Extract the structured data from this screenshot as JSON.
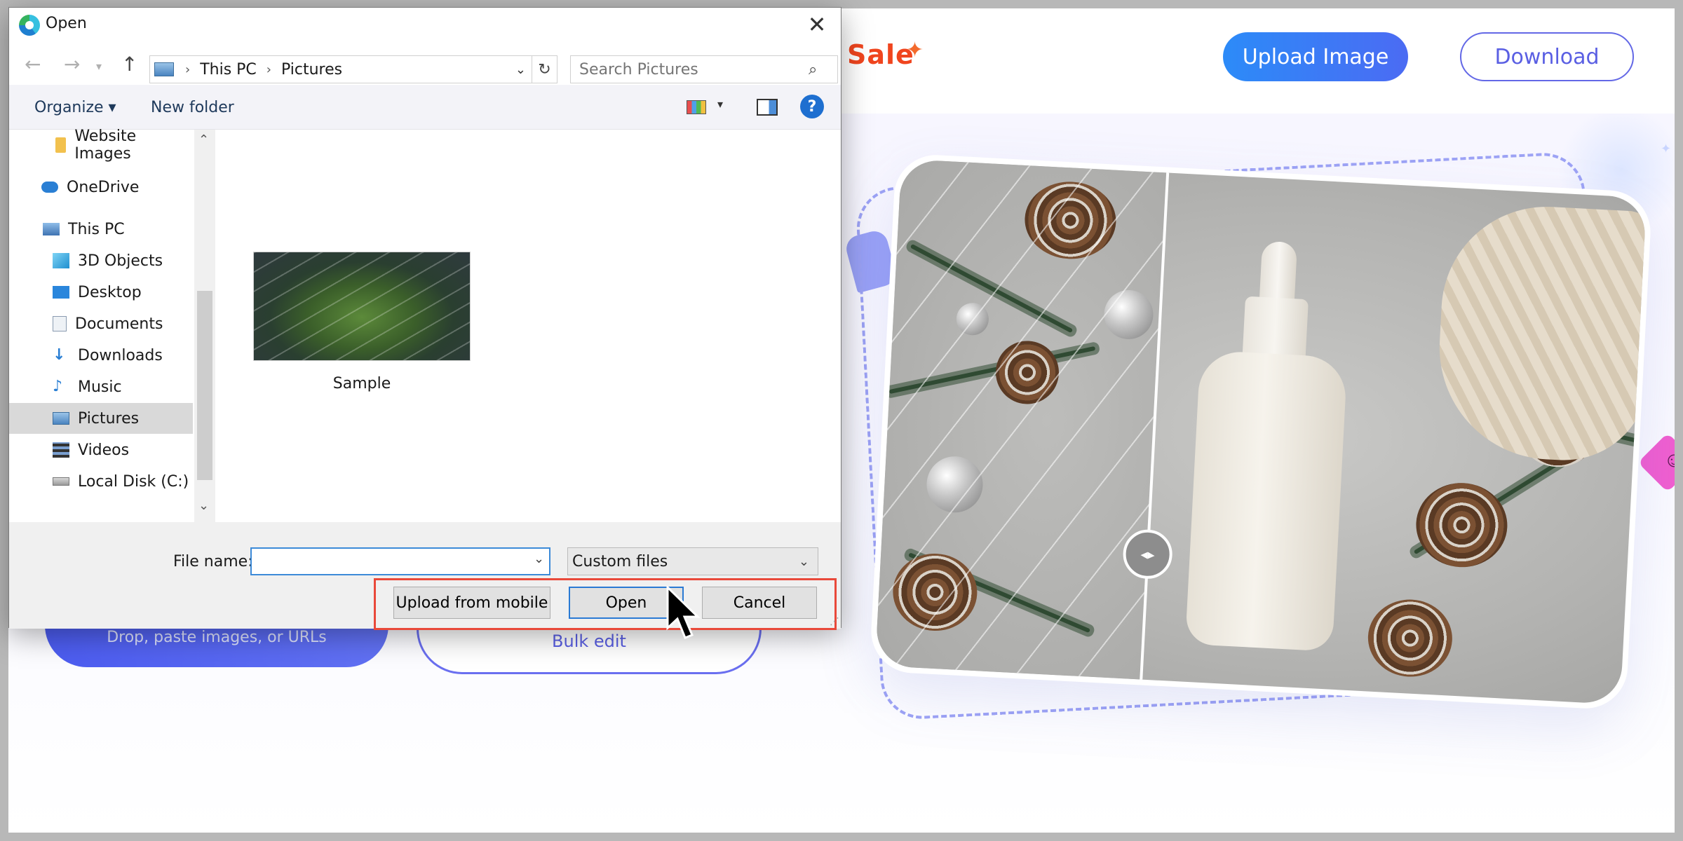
{
  "webpage": {
    "sale_text": "Sale",
    "upload_image_label": "Upload Image",
    "download_label": "Download",
    "drop_text": "Drop, paste images, or URLs",
    "bulk_edit_label": "Bulk edit",
    "handle_glyph": "◂▸"
  },
  "dialog": {
    "title": "Open",
    "breadcrumb": [
      "This PC",
      "Pictures"
    ],
    "search_placeholder": "Search Pictures",
    "toolbar": {
      "organize_label": "Organize ▾",
      "new_folder_label": "New folder",
      "help_label": "?"
    },
    "nav_items": [
      {
        "label": "Website Images",
        "icon": "folder-icon"
      },
      {
        "label": "OneDrive",
        "icon": "cloud-icon"
      },
      {
        "label": "This PC",
        "icon": "computer-icon"
      },
      {
        "label": "3D Objects",
        "icon": "cube-icon"
      },
      {
        "label": "Desktop",
        "icon": "desktop-icon"
      },
      {
        "label": "Documents",
        "icon": "document-icon"
      },
      {
        "label": "Downloads",
        "icon": "download-arrow-icon"
      },
      {
        "label": "Music",
        "icon": "music-note-icon"
      },
      {
        "label": "Pictures",
        "icon": "pictures-icon",
        "selected": true
      },
      {
        "label": "Videos",
        "icon": "film-icon"
      },
      {
        "label": "Local Disk (C:)",
        "icon": "disk-icon"
      }
    ],
    "files": [
      {
        "name": "Sample"
      }
    ],
    "file_name_label": "File name:",
    "file_name_value": "",
    "file_type_value": "Custom files",
    "buttons": {
      "upload_mobile": "Upload from mobile",
      "open": "Open",
      "cancel": "Cancel"
    }
  },
  "colors": {
    "accent_blue": "#2c8bf8",
    "accent_purple": "#5a5fe3",
    "sale_red": "#f0451e",
    "highlight_red": "#e9493a"
  }
}
